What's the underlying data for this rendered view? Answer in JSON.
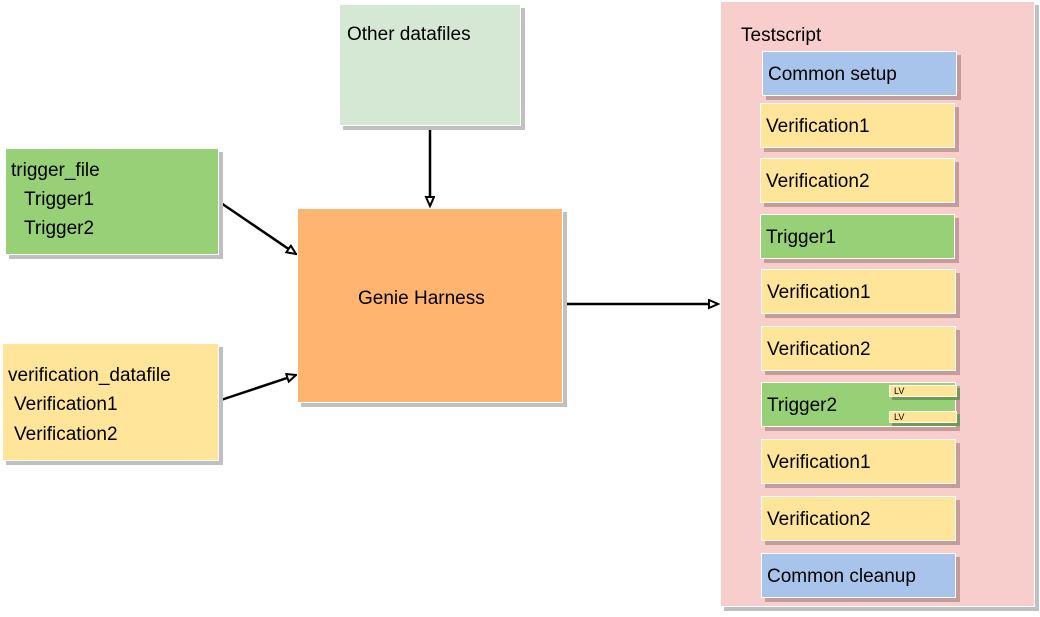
{
  "trigger_file": {
    "title": "trigger_file",
    "items": [
      "Trigger1",
      "Trigger2"
    ]
  },
  "verification_datafile": {
    "title": "verification_datafile",
    "items": [
      "Verification1",
      "Verification2"
    ]
  },
  "other_datafiles": {
    "title": "Other datafiles"
  },
  "genie_harness": {
    "title": "Genie Harness"
  },
  "testscript": {
    "title": "Testscript",
    "sections": [
      {
        "label": "Common setup",
        "type": "setup"
      },
      {
        "label": "Verification1",
        "type": "verification"
      },
      {
        "label": "Verification2",
        "type": "verification"
      },
      {
        "label": "Trigger1",
        "type": "trigger"
      },
      {
        "label": "Verification1",
        "type": "verification"
      },
      {
        "label": "Verification2",
        "type": "verification"
      },
      {
        "label": "Trigger2",
        "type": "trigger",
        "local_verifications": [
          "LV",
          "LV"
        ]
      },
      {
        "label": "Verification1",
        "type": "verification"
      },
      {
        "label": "Verification2",
        "type": "verification"
      },
      {
        "label": "Common cleanup",
        "type": "cleanup"
      }
    ]
  },
  "colors": {
    "trigger": "#97d077",
    "verification": "#ffe599",
    "common": "#a9c4eb",
    "other_datafiles": "#d5e8d4",
    "harness": "#ffb570",
    "testscript": "#f8cecc"
  }
}
